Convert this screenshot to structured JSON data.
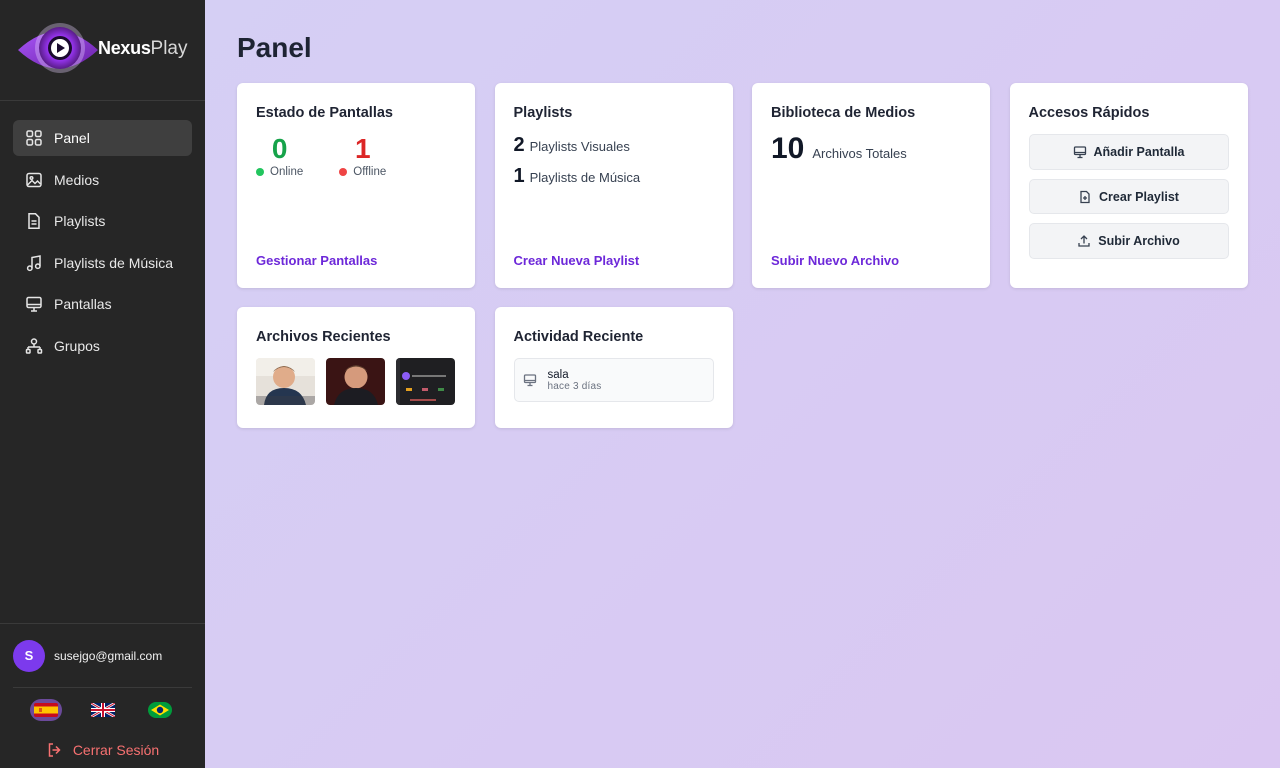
{
  "brand": {
    "name_bold": "Nexus",
    "name_light": "Play"
  },
  "nav": {
    "items": [
      {
        "label": "Panel",
        "icon": "grid-icon",
        "active": true
      },
      {
        "label": "Medios",
        "icon": "image-icon"
      },
      {
        "label": "Playlists",
        "icon": "document-icon"
      },
      {
        "label": "Playlists de Música",
        "icon": "music-icon"
      },
      {
        "label": "Pantallas",
        "icon": "monitor-icon"
      },
      {
        "label": "Grupos",
        "icon": "group-icon"
      }
    ]
  },
  "user": {
    "initial": "S",
    "email": "susejgo@gmail.com"
  },
  "languages": [
    "es",
    "en",
    "pt-br"
  ],
  "logout_label": "Cerrar Sesión",
  "page": {
    "title": "Panel"
  },
  "screens_card": {
    "title": "Estado de Pantallas",
    "online_count": "0",
    "online_label": "Online",
    "offline_count": "1",
    "offline_label": "Offline",
    "link": "Gestionar Pantallas"
  },
  "playlists_card": {
    "title": "Playlists",
    "visual_count": "2",
    "visual_label": "Playlists Visuales",
    "music_count": "1",
    "music_label": "Playlists de Música",
    "link": "Crear Nueva Playlist"
  },
  "library_card": {
    "title": "Biblioteca de Medios",
    "total_count": "10",
    "total_label": "Archivos Totales",
    "link": "Subir Nuevo Archivo"
  },
  "quick_access": {
    "title": "Accesos Rápidos",
    "add_screen": "Añadir Pantalla",
    "create_playlist": "Crear Playlist",
    "upload_file": "Subir Archivo"
  },
  "recent_files": {
    "title": "Archivos Recientes"
  },
  "recent_activity": {
    "title": "Actividad Reciente",
    "items": [
      {
        "name": "sala",
        "time": "hace 3 días"
      }
    ]
  },
  "colors": {
    "accent": "#6d28d9",
    "online": "#16a34a",
    "offline": "#dc2626",
    "logout": "#f87171"
  }
}
